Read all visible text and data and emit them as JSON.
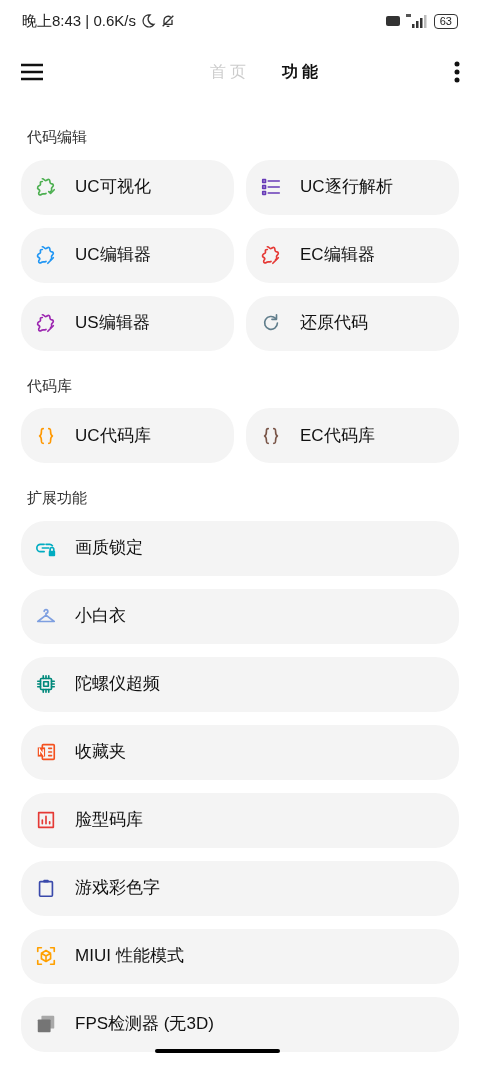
{
  "status_bar": {
    "time": "晚上8:43 | 0.6K/s",
    "battery": "63"
  },
  "header": {
    "tabs": [
      {
        "label": "首 页",
        "selected": false
      },
      {
        "label": "功 能",
        "selected": true
      }
    ]
  },
  "sections": [
    {
      "title": "代码编辑",
      "kind": "grid",
      "items": [
        {
          "label": "UC可视化",
          "kind": "puzzle-check",
          "color": "#4caf50"
        },
        {
          "label": "UC逐行解析",
          "kind": "list",
          "color": "#673ab7"
        },
        {
          "label": "UC编辑器",
          "kind": "puzzle-pen",
          "color": "#2196f3"
        },
        {
          "label": "EC编辑器",
          "kind": "puzzle-pen",
          "color": "#e53935"
        },
        {
          "label": "US编辑器",
          "kind": "puzzle-pen",
          "color": "#9c27b0"
        },
        {
          "label": "还原代码",
          "kind": "refresh",
          "color": "#607d8b"
        }
      ]
    },
    {
      "title": "代码库",
      "kind": "grid",
      "items": [
        {
          "label": "UC代码库",
          "kind": "braces",
          "color": "#ff9800"
        },
        {
          "label": "EC代码库",
          "kind": "braces",
          "color": "#795548"
        }
      ]
    },
    {
      "title": "扩展功能",
      "kind": "list",
      "items": [
        {
          "label": "画质锁定",
          "kind": "link-lock",
          "color": "#00acc1"
        },
        {
          "label": "小白衣",
          "kind": "hanger",
          "color": "#7e9fe0"
        },
        {
          "label": "陀螺仪超频",
          "kind": "chip",
          "color": "#00897b"
        },
        {
          "label": "收藏夹",
          "kind": "notebook",
          "color": "#f4511e"
        },
        {
          "label": "脸型码库",
          "kind": "chart",
          "color": "#e53935"
        },
        {
          "label": "游戏彩色字",
          "kind": "clipboard",
          "color": "#3949ab"
        },
        {
          "label": "MIUI 性能模式",
          "kind": "cube",
          "color": "#ffa000"
        },
        {
          "label": "FPS检测器 (无3D)",
          "kind": "stack",
          "color": "#757575"
        }
      ]
    }
  ]
}
